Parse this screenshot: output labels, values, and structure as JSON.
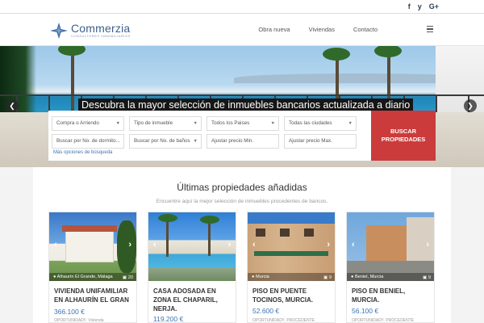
{
  "header": {
    "social": [
      "f",
      "y",
      "G+"
    ],
    "logo_name": "Commerzia",
    "logo_tagline": "CONSULTORES INMOBILIARIOS",
    "nav": [
      "Obra nueva",
      "Viviendas",
      "Contacto"
    ]
  },
  "hero": {
    "title": "Descubra la mayor selección de inmuebles bancarios actualizada a diario"
  },
  "search": {
    "operation": "Compra o Arriendo",
    "property_type": "Tipo de inmueble",
    "countries": "Todos los Paises",
    "cities": "Todas las ciudades",
    "bedrooms": "Buscar por No. de dormito...",
    "bathrooms": "Buscar por No. de baños",
    "price_min": "Ajustar precio Min.",
    "price_max": "Ajustar precio Max.",
    "more_options": "Más opciones de búsqueda",
    "button": "BUSCAR\nPROPIEDADES"
  },
  "section": {
    "title": "Últimas propiedades añadidas",
    "subtitle": "Encuentre aquí la mejor selección de inmuebles procedentes de bancos."
  },
  "properties": [
    {
      "location": "Alhaurín El Grande, Málaga",
      "photos": "20",
      "title": "VIVIENDA UNIFAMILIAR EN ALHAURÍN EL GRAN",
      "price": "366.100 €",
      "tag": "OPORTUNIDAD!!. Vivienda"
    },
    {
      "location": "",
      "photos": "",
      "title": "CASA ADOSADA EN ZONA EL CHAPARIL, NERJA.",
      "price": "119.200 €",
      "tag": ""
    },
    {
      "location": "Murcia",
      "photos": "9",
      "title": "PISO EN PUENTE TOCINOS, MURCIA.",
      "price": "52.600 €",
      "tag": "OPORTUNIDAD!!. PROCEDENTE"
    },
    {
      "location": "Beniel, Murcia",
      "photos": "9",
      "title": "PISO EN BENIEL, MURCIA.",
      "price": "56.100 €",
      "tag": "OPORTUNIDAD!!. PROCEDENTE"
    }
  ]
}
